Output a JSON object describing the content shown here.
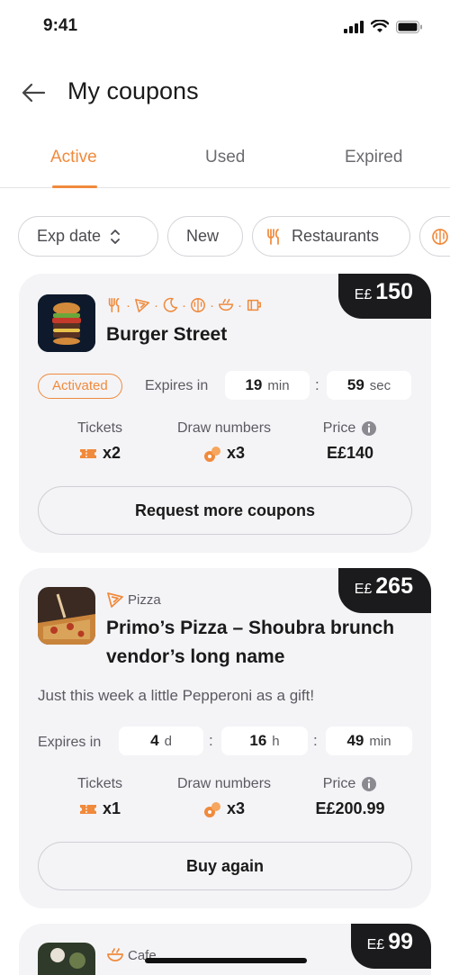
{
  "status_bar": {
    "time": "9:41"
  },
  "header": {
    "title": "My coupons"
  },
  "tabs": [
    {
      "label": "Active",
      "selected": true
    },
    {
      "label": "Used",
      "selected": false
    },
    {
      "label": "Expired",
      "selected": false
    }
  ],
  "filters": [
    {
      "label": "Exp date",
      "icon": "sort-updown-icon"
    },
    {
      "label": "New",
      "icon": ""
    },
    {
      "label": "Restaurants",
      "icon": "restaurant-icon"
    },
    {
      "label": "",
      "icon": "food-icon"
    }
  ],
  "cards": [
    {
      "price_currency": "E£",
      "price_amount": "150",
      "category_icons": [
        "restaurant-icon",
        "pizza-icon",
        "night-icon",
        "food-icon",
        "bowl-icon",
        "cup-icon"
      ],
      "name": "Burger Street",
      "status": "Activated",
      "expires_label": "Expires in",
      "timer": [
        {
          "value": "19",
          "unit": "min"
        },
        {
          "value": "59",
          "unit": "sec"
        }
      ],
      "stats": {
        "tickets_label": "Tickets",
        "tickets_value": "x2",
        "draw_label": "Draw numbers",
        "draw_value": "x3",
        "price_label": "Price",
        "price_value": "E£140"
      },
      "button_label": "Request more coupons"
    },
    {
      "price_currency": "E£",
      "price_amount": "265",
      "category_label": "Pizza",
      "name_line1": "Primo’s Pizza – Shoubra brunch",
      "name_line2": "vendor’s long name",
      "description": "Just this week a little Pepperoni as a gift!",
      "expires_label": "Expires in",
      "timer": [
        {
          "value": "4",
          "unit": "d"
        },
        {
          "value": "16",
          "unit": "h"
        },
        {
          "value": "49",
          "unit": "min"
        }
      ],
      "stats": {
        "tickets_label": "Tickets",
        "tickets_value": "x1",
        "draw_label": "Draw numbers",
        "draw_value": "x3",
        "price_label": "Price",
        "price_value": "E£200.99"
      },
      "button_label": "Buy again"
    },
    {
      "price_currency": "E£",
      "price_amount": "99",
      "category_label": "Cafe"
    }
  ],
  "colors": {
    "accent": "#f08a3c",
    "price_tag_bg": "#1b1b1d",
    "card_bg": "#f4f4f7"
  }
}
